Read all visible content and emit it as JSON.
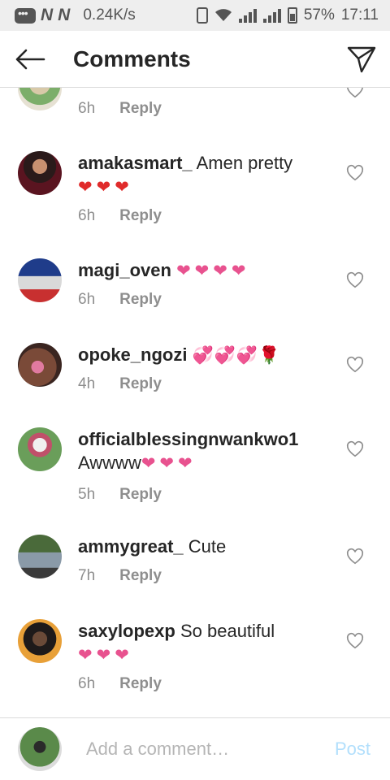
{
  "status": {
    "speed": "0.24K/s",
    "battery": "57%",
    "time": "17:11"
  },
  "header": {
    "title": "Comments"
  },
  "comments": [
    {
      "user": "",
      "text": "",
      "emoji": "",
      "time": "6h",
      "reply": "Reply"
    },
    {
      "user": "amakasmart_",
      "text": "Amen pretty",
      "emoji": "❤❤❤",
      "time": "6h",
      "reply": "Reply"
    },
    {
      "user": "magi_oven",
      "text": "",
      "emoji": "❤❤❤❤",
      "time": "6h",
      "reply": "Reply"
    },
    {
      "user": "opoke_ngozi",
      "text": "",
      "emoji": "💞💞💞🌹",
      "time": "4h",
      "reply": "Reply"
    },
    {
      "user": "officialblessingnwankwo1",
      "text": "Awwww",
      "emoji": "❤❤❤",
      "time": "5h",
      "reply": "Reply"
    },
    {
      "user": "ammygreat_",
      "text": "Cute",
      "emoji": "",
      "time": "7h",
      "reply": "Reply"
    },
    {
      "user": "saxylopexp",
      "text": "So beautiful",
      "emoji": "❤❤❤",
      "time": "6h",
      "reply": "Reply"
    }
  ],
  "composer": {
    "placeholder": "Add a comment…",
    "post_label": "Post"
  },
  "colors": {
    "accent": "#3897f0",
    "post_disabled": "#b2dffc",
    "heart": "#e8528f"
  }
}
